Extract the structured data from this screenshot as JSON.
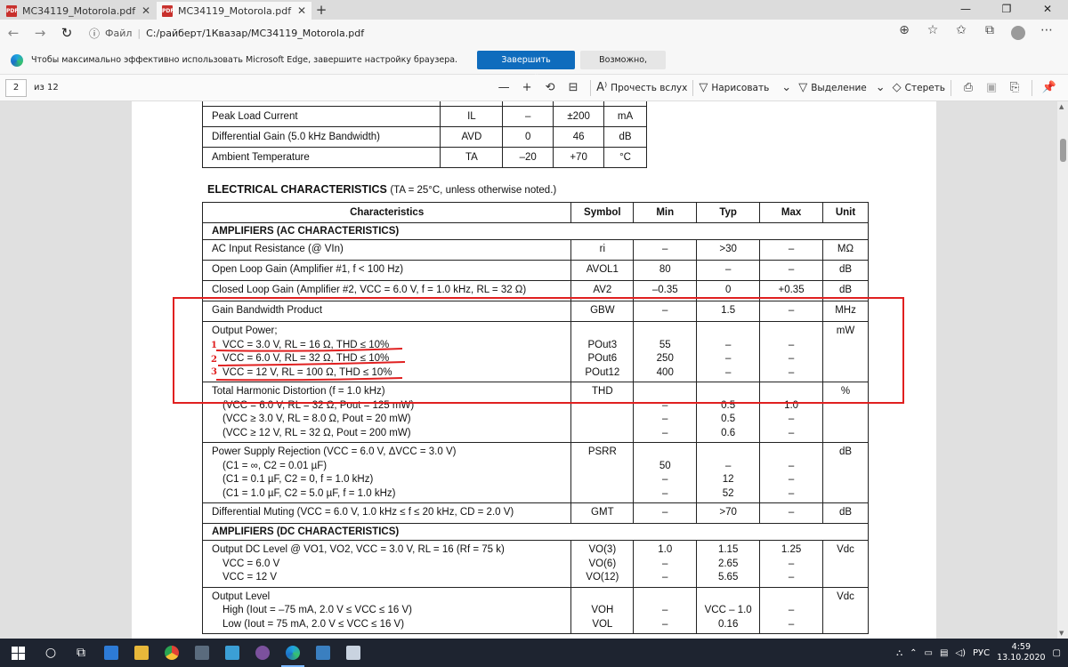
{
  "browser": {
    "tabs": [
      {
        "label": "MC34119_Motorola.pdf",
        "active": false
      },
      {
        "label": "MC34119_Motorola.pdf",
        "active": true
      }
    ],
    "new_tab": "+",
    "window_controls": {
      "minimize": "—",
      "restore": "❐",
      "close": "✕"
    },
    "address": {
      "prefix": "Файл",
      "url": "C:/райберт/1Квазар/MC34119_Motorola.pdf"
    }
  },
  "banner": {
    "text": "Чтобы максимально эффективно использовать Microsoft Edge, завершите настройку браузера.",
    "primary": "Завершить настройку",
    "secondary": "Возможно, позднее"
  },
  "pdf_toolbar": {
    "page": "2",
    "of_total": "из 12",
    "minus": "—",
    "plus": "+",
    "read_aloud": "Прочесть вслух",
    "draw": "Нарисовать",
    "highlight": "Выделение",
    "erase": "Стереть"
  },
  "top_table": {
    "rows": [
      {
        "name": "",
        "symbol": "",
        "min": "",
        "max": "",
        "unit": ""
      },
      {
        "name": "Peak Load Current",
        "symbol": "IL",
        "min": "–",
        "max": "±200",
        "unit": "mA"
      },
      {
        "name": "Differential Gain (5.0 kHz Bandwidth)",
        "symbol": "AVD",
        "min": "0",
        "max": "46",
        "unit": "dB"
      },
      {
        "name": "Ambient Temperature",
        "symbol": "TA",
        "min": "–20",
        "max": "+70",
        "unit": "°C"
      }
    ]
  },
  "ec": {
    "title": "ELECTRICAL CHARACTERISTICS",
    "note": "(TA = 25°C, unless otherwise noted.)",
    "headers": {
      "characteristics": "Characteristics",
      "symbol": "Symbol",
      "min": "Min",
      "typ": "Typ",
      "max": "Max",
      "unit": "Unit"
    },
    "ac_section": "AMPLIFIERS (AC CHARACTERISTICS)",
    "dc_section": "AMPLIFIERS (DC CHARACTERISTICS)",
    "rows": {
      "input_res": {
        "name": "AC Input Resistance (@ VIn)",
        "symbol": "ri",
        "min": "–",
        "typ": ">30",
        "max": "–",
        "unit": "MΩ"
      },
      "open_loop": {
        "name": "Open Loop Gain (Amplifier #1, f < 100 Hz)",
        "symbol": "AVOL1",
        "min": "80",
        "typ": "–",
        "max": "–",
        "unit": "dB"
      },
      "closed_loop": {
        "name": "Closed Loop Gain (Amplifier #2, VCC = 6.0 V, f = 1.0 kHz, RL = 32 Ω)",
        "symbol": "AV2",
        "min": "–0.35",
        "typ": "0",
        "max": "+0.35",
        "unit": "dB"
      },
      "gbw": {
        "name": "Gain Bandwidth Product",
        "symbol": "GBW",
        "min": "–",
        "typ": "1.5",
        "max": "–",
        "unit": "MHz"
      },
      "output_power": {
        "name": "Output Power;",
        "lines": [
          "VCC = 3.0 V, RL = 16 Ω, THD ≤ 10%",
          "VCC = 6.0 V, RL =  32 Ω, THD ≤ 10%",
          "VCC = 12 V, RL =  100 Ω, THD ≤ 10%"
        ],
        "symbols": [
          "POut3",
          "POut6",
          "POut12"
        ],
        "min": [
          "55",
          "250",
          "400"
        ],
        "typ": [
          "–",
          "–",
          "–"
        ],
        "max": [
          "–",
          "–",
          "–"
        ],
        "unit": "mW"
      },
      "thd": {
        "name": "Total Harmonic Distortion (f = 1.0 kHz)",
        "lines": [
          "(VCC = 6.0 V, RL = 32 Ω, Pout = 125 mW)",
          "(VCC ≥ 3.0 V, RL = 8.0 Ω, Pout = 20 mW)",
          "(VCC ≥ 12 V, RL = 32 Ω, Pout = 200 mW)"
        ],
        "symbol": "THD",
        "min": [
          "–",
          "–",
          "–"
        ],
        "typ": [
          "0.5",
          "0.5",
          "0.6"
        ],
        "max": [
          "1.0",
          "–",
          "–"
        ],
        "unit": "%"
      },
      "psrr": {
        "name": "Power Supply Rejection (VCC = 6.0 V, ΔVCC = 3.0 V)",
        "lines": [
          "(C1 = ∞, C2 = 0.01 µF)",
          "(C1 = 0.1 µF, C2 = 0, f = 1.0 kHz)",
          "(C1 = 1.0 µF, C2 = 5.0 µF, f = 1.0 kHz)"
        ],
        "symbol": "PSRR",
        "min": [
          "50",
          "–",
          "–"
        ],
        "typ": [
          "–",
          "12",
          "52"
        ],
        "max": [
          "–",
          "–",
          "–"
        ],
        "unit": "dB"
      },
      "gmt": {
        "name": "Differential Muting (VCC = 6.0 V, 1.0 kHz ≤ f ≤ 20 kHz, CD = 2.0 V)",
        "symbol": "GMT",
        "min": "–",
        "typ": ">70",
        "max": "–",
        "unit": "dB"
      },
      "dc_level": {
        "name": "Output DC Level @ VO1, VO2, VCC = 3.0 V, RL = 16 (Rf = 75 k)",
        "lines": [
          "VCC = 6.0 V",
          "VCC = 12 V"
        ],
        "symbols": [
          "VO(3)",
          "VO(6)",
          "VO(12)"
        ],
        "min": [
          "1.0",
          "–",
          "–"
        ],
        "typ": [
          "1.15",
          "2.65",
          "5.65"
        ],
        "max": [
          "1.25",
          "–",
          "–"
        ],
        "unit": "Vdc"
      },
      "out_level": {
        "name": "Output Level",
        "lines": [
          "High (Iout = –75 mA, 2.0 V ≤ VCC ≤ 16 V)",
          "Low (Iout = 75 mA, 2.0 V ≤ VCC ≤ 16 V)"
        ],
        "symbols": [
          "VOH",
          "VOL"
        ],
        "min": [
          "–",
          "–"
        ],
        "typ": [
          "VCC – 1.0",
          "0.16"
        ],
        "max": [
          "–",
          "–"
        ],
        "unit": "Vdc"
      }
    }
  },
  "annotations": {
    "marks": [
      "1",
      "2",
      "3"
    ],
    "color": "#e02020"
  },
  "taskbar": {
    "lang": "РУС",
    "time": "4:59",
    "date": "13.10.2020"
  }
}
